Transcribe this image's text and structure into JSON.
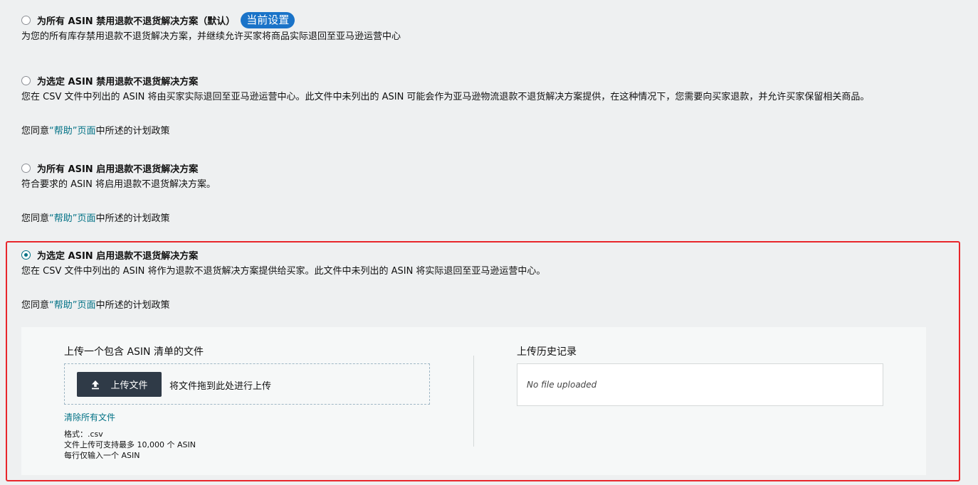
{
  "options": [
    {
      "title": "为所有 ASIN 禁用退款不退货解决方案（默认）",
      "badge": "当前设置",
      "description": "为您的所有库存禁用退款不退货解决方案，并继续允许买家将商品实际退回至亚马逊运营中心",
      "checked": false
    },
    {
      "title": "为选定 ASIN 禁用退款不退货解决方案",
      "description": "您在 CSV 文件中列出的 ASIN 将由买家实际退回至亚马逊运营中心。此文件中未列出的 ASIN 可能会作为亚马逊物流退款不退货解决方案提供，在这种情况下，您需要向买家退款，并允许买家保留相关商品。",
      "policy_prefix": "您同意",
      "policy_link": "“帮助”页面",
      "policy_suffix": "中所述的计划政策",
      "checked": false
    },
    {
      "title": "为所有 ASIN 启用退款不退货解决方案",
      "description": "符合要求的 ASIN 将启用退款不退货解决方案。",
      "policy_prefix": "您同意",
      "policy_link": "“帮助”页面",
      "policy_suffix": "中所述的计划政策",
      "checked": false
    },
    {
      "title": "为选定 ASIN 启用退款不退货解决方案",
      "description": "您在 CSV 文件中列出的 ASIN 将作为退款不退货解决方案提供给买家。此文件中未列出的 ASIN 将实际退回至亚马逊运营中心。",
      "policy_prefix": "您同意",
      "policy_link": "“帮助”页面",
      "policy_suffix": "中所述的计划政策",
      "checked": true
    }
  ],
  "upload": {
    "title": "上传一个包含 ASIN 清单的文件",
    "button_label": "上传文件",
    "drop_hint": "将文件拖到此处进行上传",
    "clear_label": "清除所有文件",
    "hints": [
      "格式：.csv",
      "文件上传可支持最多 10,000 个 ASIN",
      "每行仅输入一个 ASIN"
    ],
    "icon": "upload-icon"
  },
  "history": {
    "title": "上传历史记录",
    "empty_text": "No file uploaded"
  },
  "colors": {
    "accent": "#007185",
    "badge": "#1a73c8",
    "highlight_border": "#e8262b",
    "button": "#2f3a47"
  }
}
